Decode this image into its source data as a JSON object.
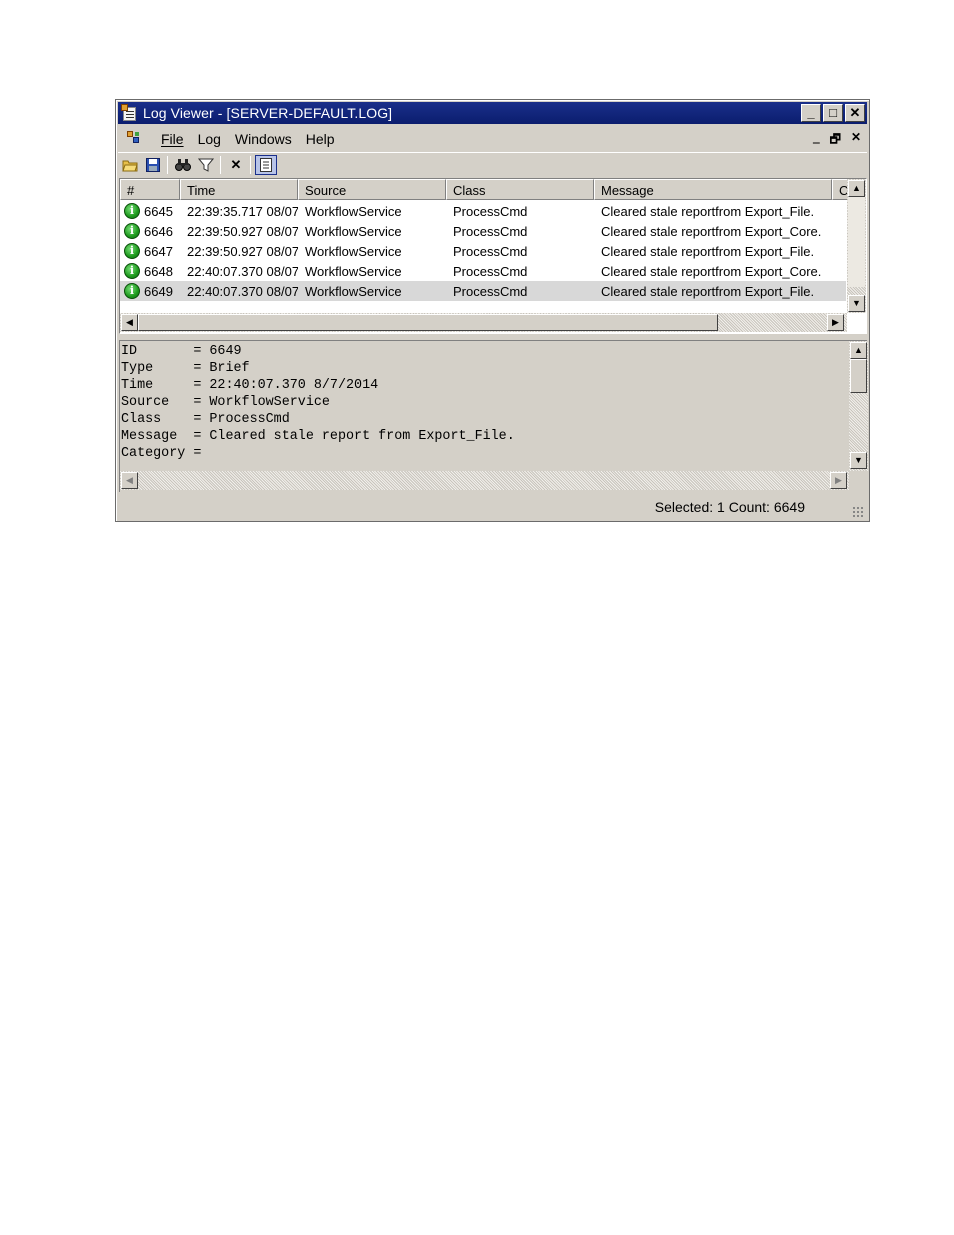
{
  "window": {
    "title": "Log Viewer - [SERVER-DEFAULT.LOG]",
    "controls": {
      "minimize": "_",
      "maximize": "□",
      "close": "✕"
    }
  },
  "menu": {
    "items": [
      {
        "label": "File"
      },
      {
        "label": "Log"
      },
      {
        "label": "Windows"
      },
      {
        "label": "Help"
      }
    ],
    "mdi_controls": {
      "minimize": "‗",
      "restore": "🗗",
      "close": "✕"
    }
  },
  "toolbar": {
    "icons": [
      "open-folder-icon",
      "save-icon",
      "find-icon",
      "filter-icon",
      "delete-icon",
      "details-toggle-icon"
    ]
  },
  "list": {
    "columns": [
      "#",
      "Time",
      "Source",
      "Class",
      "Message",
      "C"
    ],
    "rows": [
      {
        "id": "6645",
        "time": "22:39:35.717 08/07",
        "source": "WorkflowService",
        "class": "ProcessCmd",
        "message": "Cleared stale reportfrom Export_File."
      },
      {
        "id": "6646",
        "time": "22:39:50.927 08/07",
        "source": "WorkflowService",
        "class": "ProcessCmd",
        "message": "Cleared stale reportfrom Export_Core."
      },
      {
        "id": "6647",
        "time": "22:39:50.927 08/07",
        "source": "WorkflowService",
        "class": "ProcessCmd",
        "message": "Cleared stale reportfrom Export_File."
      },
      {
        "id": "6648",
        "time": "22:40:07.370 08/07",
        "source": "WorkflowService",
        "class": "ProcessCmd",
        "message": "Cleared stale reportfrom Export_Core."
      },
      {
        "id": "6649",
        "time": "22:40:07.370 08/07",
        "source": "WorkflowService",
        "class": "ProcessCmd",
        "message": "Cleared stale reportfrom Export_File."
      }
    ],
    "selected_row": 4
  },
  "detail": {
    "lines": [
      "ID       = 6649",
      "Type     = Brief",
      "Time     = 22:40:07.370 8/7/2014",
      "Source   = WorkflowService",
      "Class    = ProcessCmd",
      "Message  = Cleared stale report from Export_File.",
      "Category ="
    ]
  },
  "status": {
    "text": "Selected: 1  Count: 6649"
  },
  "colors": {
    "titlebar": "#0b1d6e",
    "chrome": "#d4d0c8",
    "selection": "#d8d8d8",
    "info": "#1d9a1d"
  }
}
